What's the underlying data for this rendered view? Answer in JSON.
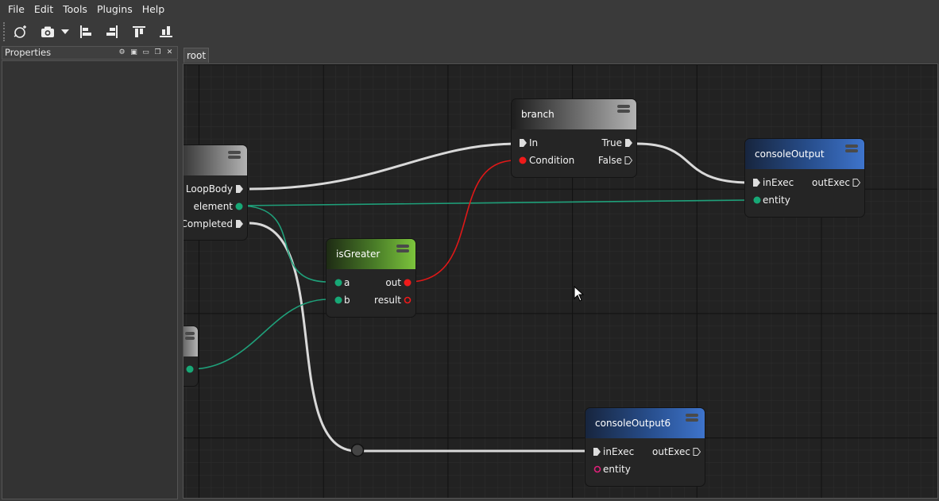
{
  "menu": {
    "items": [
      "File",
      "Edit",
      "Tools",
      "Plugins",
      "Help"
    ]
  },
  "toolbar": {
    "icons": [
      "node-add-icon",
      "camera-icon",
      "dropdown-arrow-icon",
      "align-left-icon",
      "align-right-icon",
      "align-top-icon",
      "align-bottom-icon"
    ]
  },
  "properties": {
    "title": "Properties"
  },
  "tabs": {
    "active": "root"
  },
  "colors": {
    "exec_wire": "#d9d9d9",
    "data_wire": "#1fa07a",
    "bool_wire": "#e01818",
    "data_pin": "#17a876",
    "bool_pin": "#ee1a1a",
    "entity_pin_unconnected": "#e0207a"
  },
  "nodes": {
    "loop": {
      "pins": [
        "LoopBody",
        "element",
        "Completed"
      ]
    },
    "branch": {
      "title": "branch",
      "in": [
        "In",
        "Condition"
      ],
      "out": [
        "True",
        "False"
      ]
    },
    "is_greater": {
      "title": "isGreater",
      "in": [
        "a",
        "b"
      ],
      "out": [
        "out",
        "result"
      ]
    },
    "console_output": {
      "title": "consoleOutput",
      "in": [
        "inExec",
        "entity"
      ],
      "out": [
        "outExec"
      ]
    },
    "console_output6": {
      "title": "consoleOutput6",
      "in": [
        "inExec",
        "entity"
      ],
      "out": [
        "outExec"
      ]
    }
  }
}
